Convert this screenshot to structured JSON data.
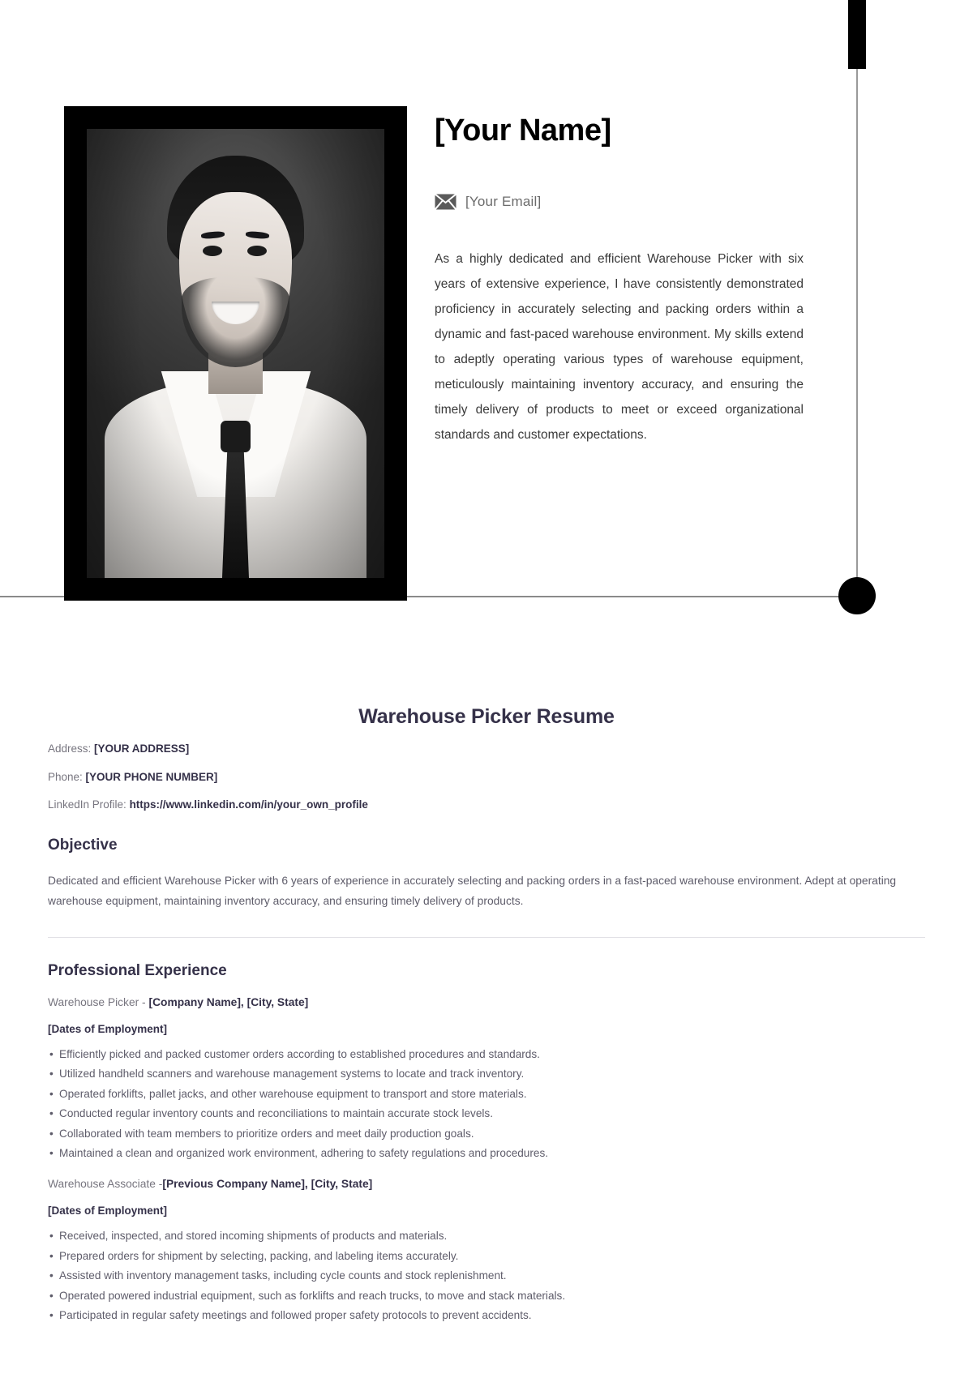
{
  "hero": {
    "name": "[Your Name]",
    "email_icon": "envelope-icon",
    "email": "[Your Email]",
    "summary": "As a highly dedicated and efficient Warehouse Picker with six years of extensive experience, I have consistently demonstrated proficiency in accurately selecting and packing orders within a dynamic and fast-paced warehouse environment. My skills extend to adeptly operating various types of warehouse equipment, meticulously maintaining inventory accuracy, and ensuring the timely delivery of products to meet or exceed organizational standards and customer expectations.",
    "photo_alt": "black-and-white portrait of a smiling man in white shirt and dark tie"
  },
  "decor": {
    "bar_color": "#000000",
    "line_color": "#9a9a9a",
    "dot_color": "#000000"
  },
  "document": {
    "title": "Warehouse Picker Resume",
    "contact": {
      "address_label": "Address: ",
      "address_value": "[YOUR ADDRESS]",
      "phone_label": "Phone: ",
      "phone_value": "[YOUR PHONE NUMBER]",
      "linkedin_label": "LinkedIn Profile: ",
      "linkedin_value": "https://www.linkedin.com/in/your_own_profile"
    },
    "objective": {
      "heading": "Objective",
      "text": "Dedicated and efficient Warehouse Picker with 6 years of experience in accurately selecting and packing orders in a fast-paced warehouse environment. Adept at operating warehouse equipment, maintaining inventory accuracy, and ensuring timely delivery of products."
    },
    "experience": {
      "heading": "Professional Experience",
      "jobs": [
        {
          "role_prefix": "Warehouse Picker - ",
          "company": "[Company Name], [City, State]",
          "dates": "[Dates of Employment]",
          "bullets": [
            "Efficiently picked and packed customer orders according to established procedures and standards.",
            "Utilized handheld scanners and warehouse management systems to locate and track inventory.",
            "Operated forklifts, pallet jacks, and other warehouse equipment to transport and store materials.",
            "Conducted regular inventory counts and reconciliations to maintain accurate stock levels.",
            "Collaborated with team members to prioritize orders and meet daily production goals.",
            "Maintained a clean and organized work environment, adhering to safety regulations and procedures."
          ]
        },
        {
          "role_prefix": "Warehouse Associate -",
          "company": "[Previous Company Name], [City, State]",
          "dates": "[Dates of Employment]",
          "bullets": [
            "Received, inspected, and stored incoming shipments of products and materials.",
            "Prepared orders for shipment by selecting, packing, and labeling items accurately.",
            "Assisted with inventory management tasks, including cycle counts and stock replenishment.",
            "Operated powered industrial equipment, such as forklifts and reach trucks, to move and stack materials.",
            "Participated in regular safety meetings and followed proper safety protocols to prevent accidents."
          ]
        }
      ]
    }
  },
  "colors": {
    "heading": "#353149",
    "body_text": "#5e5c6a",
    "muted": "#77757f",
    "hero_text": "#3a3a3a"
  }
}
